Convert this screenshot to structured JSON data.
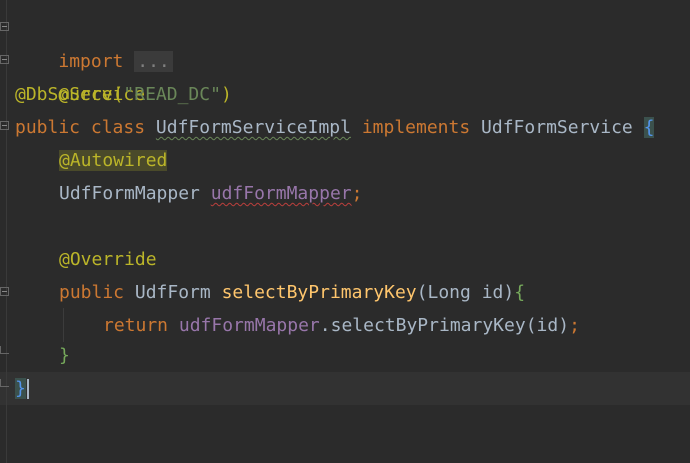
{
  "code": {
    "line1": {
      "keyword": "import",
      "folded": "..."
    },
    "line2": {
      "annotation": "@Service"
    },
    "line3": {
      "annotation": "@DbSource",
      "open_paren": "(",
      "string": "\"READ_DC\"",
      "close_paren": ")"
    },
    "line4": {
      "public": "public",
      "class": "class",
      "class_name": "UdfFormServiceImpl",
      "implements": "implements",
      "interface_name": "UdfFormService",
      "brace": "{"
    },
    "line5": {
      "annotation": "@Autowired"
    },
    "line6": {
      "type": "UdfFormMapper",
      "field": "udfFormMapper",
      "semicolon": ";"
    },
    "line8": {
      "annotation": "@Override"
    },
    "line9": {
      "public": "public",
      "return_type": "UdfForm",
      "method": "selectByPrimaryKey",
      "open_paren": "(",
      "param_type": "Long",
      "param_name": "id",
      "close_paren": ")",
      "brace": "{"
    },
    "line10": {
      "return": "return",
      "field": "udfFormMapper",
      "dot": ".",
      "call": "selectByPrimaryKey",
      "open_paren": "(",
      "arg": "id",
      "close_paren": ")",
      "semicolon": ";"
    },
    "line11": {
      "brace": "}"
    },
    "line12": {
      "brace": "}"
    }
  },
  "colors": {
    "background": "#2b2b2b",
    "keyword": "#cc7832",
    "annotation": "#bbb529",
    "string": "#6a8759",
    "field": "#9876aa",
    "method": "#ffc66d",
    "text": "#a9b7c6"
  }
}
